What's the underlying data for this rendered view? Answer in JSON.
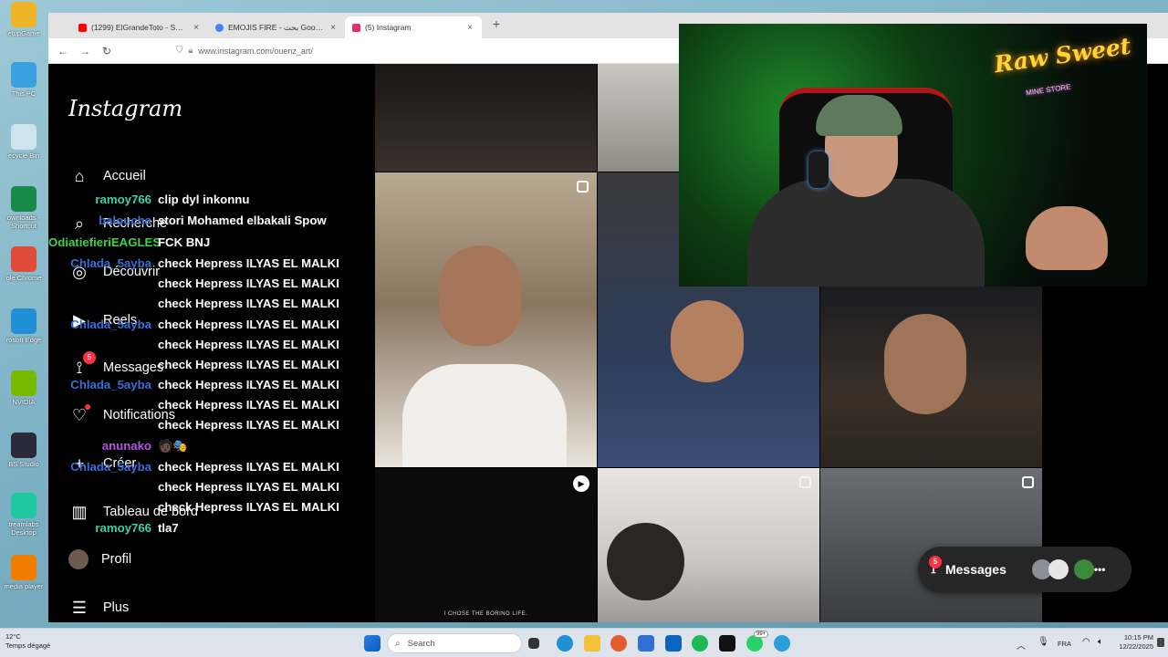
{
  "desktop": {
    "icons": [
      {
        "label": "etupGame",
        "color": "#f0b429"
      },
      {
        "label": "This PC",
        "color": "#3aa0e0"
      },
      {
        "label": "ecycle Bin",
        "color": "#cfe3ee"
      },
      {
        "label": "ownloads -\nShortcut",
        "color": "#1a8a4a"
      },
      {
        "label": "gle Chrome",
        "color": "#e04b3a"
      },
      {
        "label": "rosoft Edge",
        "color": "#1f8fd6"
      },
      {
        "label": "NVIDIA",
        "color": "#76b900"
      },
      {
        "label": "BS Studio",
        "color": "#2a2a3a"
      },
      {
        "label": "treamlabs\nDesktop",
        "color": "#1fc8a0"
      },
      {
        "label": "media player",
        "color": "#f07d00"
      }
    ]
  },
  "browser": {
    "tabs": [
      {
        "title": "(1299) ElGrandeToto - Sarcelles",
        "color": "#ff0000"
      },
      {
        "title": "EMOJIS FIRE - بحث Google",
        "color": "#4285f4"
      },
      {
        "title": "(5) Instagram",
        "color": "#e1306c"
      }
    ],
    "new_tab": "+",
    "url": "www.instagram.com/ouenz_art/"
  },
  "instagram": {
    "logo": "Instagram",
    "nav": [
      {
        "label": "Accueil",
        "icon": "home-icon"
      },
      {
        "label": "Recherche",
        "icon": "search-icon"
      },
      {
        "label": "Découvrir",
        "icon": "compass-icon"
      },
      {
        "label": "Reels",
        "icon": "reels-icon"
      },
      {
        "label": "Messages",
        "icon": "messenger-icon",
        "badge": "5"
      },
      {
        "label": "Notifications",
        "icon": "heart-icon"
      },
      {
        "label": "Créer",
        "icon": "plus-icon"
      },
      {
        "label": "Tableau de bord",
        "icon": "dashboard-icon"
      },
      {
        "label": "Profil",
        "icon": "avatar-icon"
      },
      {
        "label": "Plus",
        "icon": "menu-icon"
      }
    ],
    "messages_pill": {
      "label": "Messages",
      "badge": "5"
    },
    "reel_caption": "I CHOSE THE BORING LIFE."
  },
  "chat": [
    {
      "user": "ramoy766",
      "msg": "clip dyl inkonnu",
      "color": "#35d4b0"
    },
    {
      "user": "baloucha",
      "msg": "stori Mohamed elbakali Spow",
      "color": "#3a6fd8"
    },
    {
      "user": "OdiatiefieriEAGLES",
      "msg": "FCK BNJ",
      "color": "#3cd44a"
    },
    {
      "user": "Chlada_5ayba",
      "msg": "check Hepress ILYAS EL MALKI",
      "color": "#3a6fd8"
    },
    {
      "user": "",
      "msg": "check Hepress ILYAS EL MALKI",
      "color": "#3a6fd8"
    },
    {
      "user": "",
      "msg": "check Hepress ILYAS EL MALKI",
      "color": "#3a6fd8"
    },
    {
      "user": "Chlada_5ayba",
      "msg": "check Hepress ILYAS EL MALKI",
      "color": "#3a6fd8"
    },
    {
      "user": "",
      "msg": "check Hepress ILYAS EL MALKI",
      "color": "#3a6fd8"
    },
    {
      "user": "",
      "msg": "check Hepress ILYAS EL MALKI",
      "color": "#3a6fd8"
    },
    {
      "user": "Chlada_5ayba",
      "msg": "check Hepress ILYAS EL MALKI",
      "color": "#3a6fd8"
    },
    {
      "user": "",
      "msg": "check Hepress ILYAS EL MALKI",
      "color": "#3a6fd8"
    },
    {
      "user": "",
      "msg": "check Hepress ILYAS EL MALKI",
      "color": "#3a6fd8"
    },
    {
      "user": "anunako",
      "msg": "🧑🏿🎭",
      "color": "#b455e0"
    },
    {
      "user": "Chlada_5ayba",
      "msg": "check Hepress ILYAS EL MALKI",
      "color": "#3a6fd8"
    },
    {
      "user": "",
      "msg": "check Hepress ILYAS EL MALKI",
      "color": "#3a6fd8"
    },
    {
      "user": "",
      "msg": "check Hepress ILYAS EL MALKI",
      "color": "#3a6fd8"
    },
    {
      "user": "ramoy766",
      "msg": "tla7",
      "color": "#35d4b0"
    }
  ],
  "webcam": {
    "neon_sign": "Raw Sweet",
    "neon_sub": "MINE STORE"
  },
  "taskbar": {
    "search_placeholder": "Search",
    "weather_temp": "12°C",
    "weather_desc": "Temps dégagé",
    "lang": "FRA",
    "time": "10:15 PM",
    "date": "12/22/2025",
    "badge_99": "99+"
  }
}
